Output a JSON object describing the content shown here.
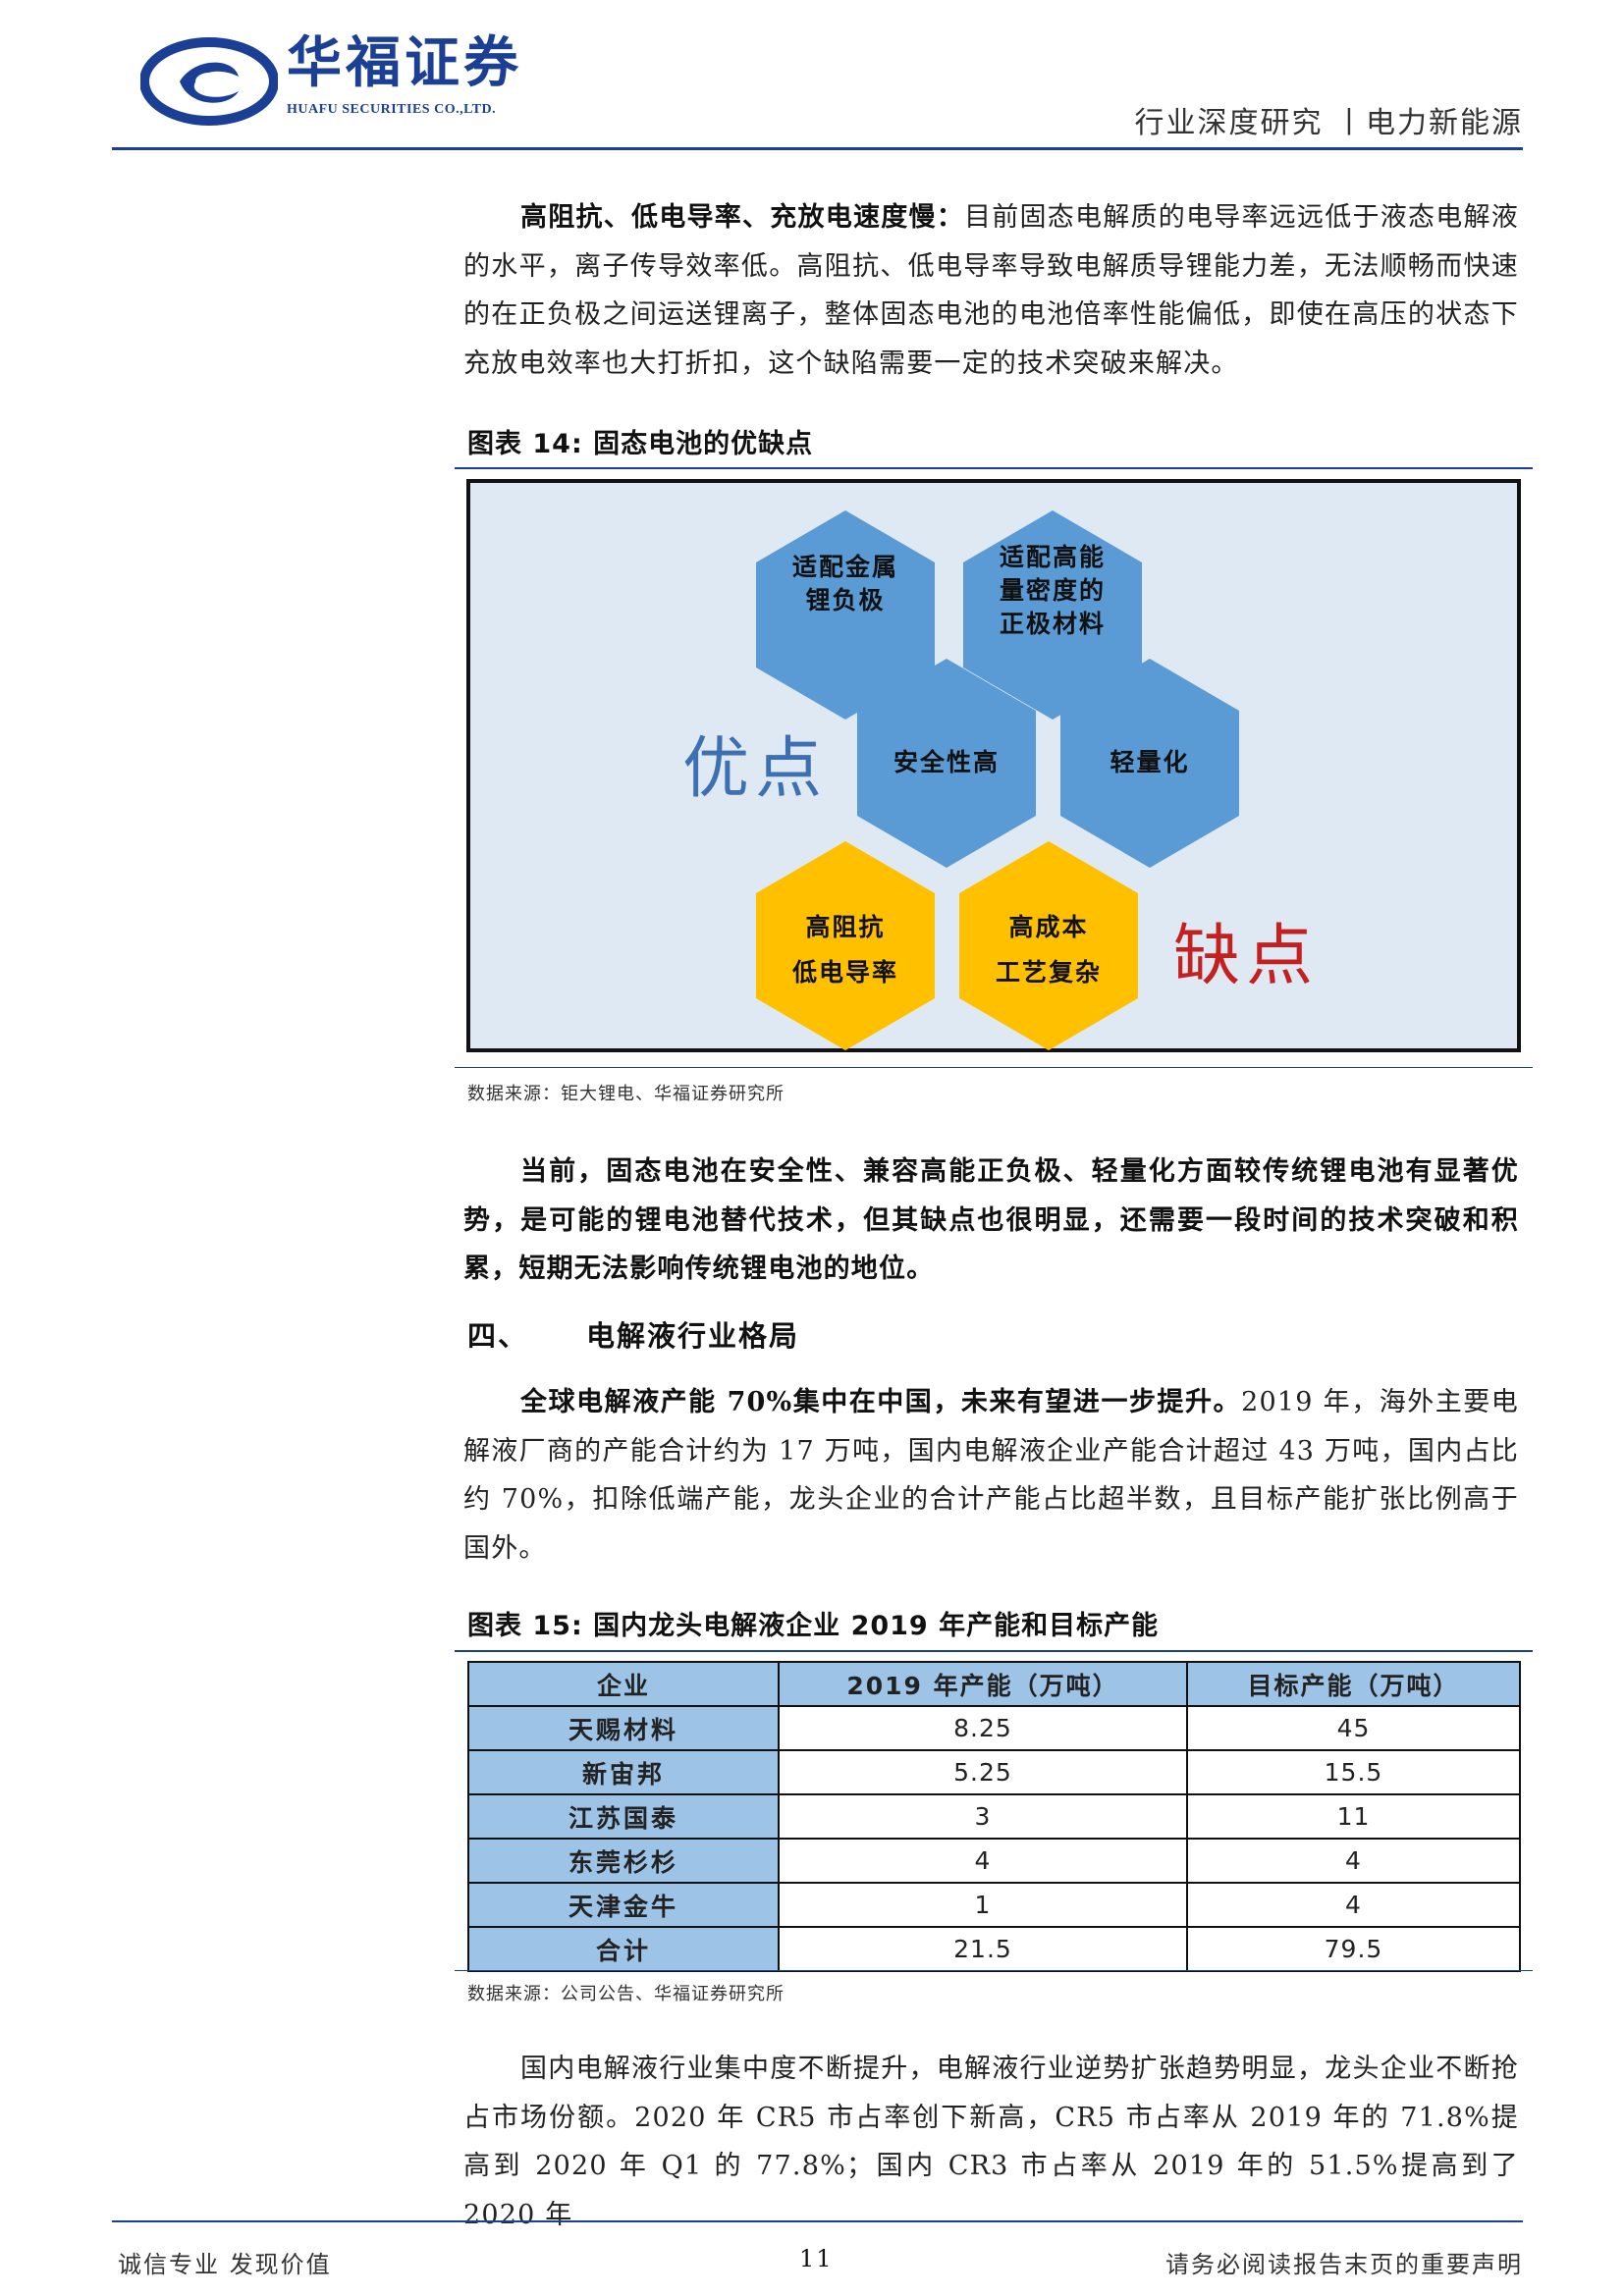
{
  "header": {
    "logo_cn": "华福证券",
    "logo_en": "HUAFU SECURITIES CO.,LTD.",
    "category": "行业深度研究 丨电力新能源"
  },
  "para1": {
    "bold": "高阻抗、低电导率、充放电速度慢：",
    "text": "目前固态电解质的电导率远远低于液态电解液的水平，离子传导效率低。高阻抗、低电导率导致电解质导锂能力差，无法顺畅而快速的在正负极之间运送锂离子，整体固态电池的电池倍率性能偏低，即使在高压的状态下充放电效率也大打折扣，这个缺陷需要一定的技术突破来解决。"
  },
  "figure14": {
    "title": "图表 14: 固态电池的优缺点",
    "pros_title": "优点",
    "cons_title": "缺点",
    "hexagons": [
      {
        "line1": "适配金属",
        "line2": "锂负极",
        "line3": ""
      },
      {
        "line1": "适配高能",
        "line2": "量密度的",
        "line3": "正极材料"
      },
      {
        "line1": "安全性高",
        "line2": "",
        "line3": ""
      },
      {
        "line1": "轻量化",
        "line2": "",
        "line3": ""
      },
      {
        "line1": "高阻抗",
        "line2": "低电导率",
        "line3": ""
      },
      {
        "line1": "高成本",
        "line2": "工艺复杂",
        "line3": ""
      }
    ],
    "colors": {
      "pro": "#5b9bd5",
      "con": "#ffc000"
    },
    "source": "数据来源：钜大锂电、华福证券研究所"
  },
  "para2": "当前，固态电池在安全性、兼容高能正负极、轻量化方面较传统锂电池有显著优势，是可能的锂电池替代技术，但其缺点也很明显，还需要一段时间的技术突破和积累，短期无法影响传统锂电池的地位。",
  "section4": {
    "number": "四、",
    "title": "电解液行业格局"
  },
  "para3": {
    "bold": "全球电解液产能 70%集中在中国，未来有望进一步提升。",
    "text": "2019 年，海外主要电解液厂商的产能合计约为 17 万吨，国内电解液企业产能合计超过 43 万吨，国内占比约 70%，扣除低端产能，龙头企业的合计产能占比超半数，且目标产能扩张比例高于国外。"
  },
  "figure15": {
    "title": "图表 15: 国内龙头电解液企业 2019 年产能和目标产能",
    "headers": [
      "企业",
      "2019 年产能（万吨）",
      "目标产能（万吨）"
    ],
    "rows": [
      [
        "天赐材料",
        "8.25",
        "45"
      ],
      [
        "新宙邦",
        "5.25",
        "15.5"
      ],
      [
        "江苏国泰",
        "3",
        "11"
      ],
      [
        "东莞杉杉",
        "4",
        "4"
      ],
      [
        "天津金牛",
        "1",
        "4"
      ],
      [
        "合计",
        "21.5",
        "79.5"
      ]
    ],
    "source": "数据来源：公司公告、华福证券研究所"
  },
  "para4": "国内电解液行业集中度不断提升，电解液行业逆势扩张趋势明显，龙头企业不断抢占市场份额。2020 年 CR5 市占率创下新高，CR5 市占率从 2019 年的 71.8%提高到 2020 年 Q1 的 77.8%；国内 CR3 市占率从 2019 年的 51.5%提高到了 2020 年",
  "footer": {
    "left": "诚信专业 发现价值",
    "page": "11",
    "right": "请务必阅读报告末页的重要声明"
  }
}
